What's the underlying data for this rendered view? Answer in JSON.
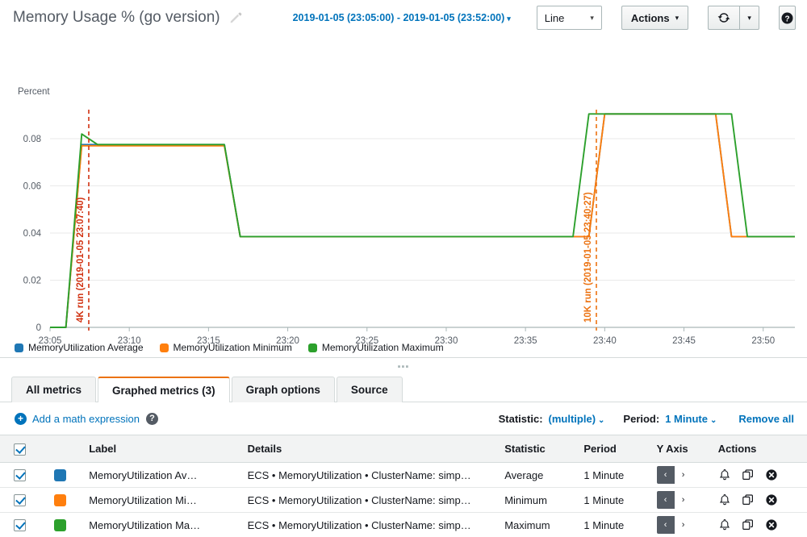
{
  "header": {
    "title": "Memory Usage % (go version)",
    "edit_icon": "pencil-icon",
    "time_range": "2019-01-05 (23:05:00) - 2019-01-05 (23:52:00)",
    "caret": "▾",
    "graph_type": "Line",
    "actions_label": "Actions",
    "refresh_icon": "refresh-icon",
    "help_label": "?"
  },
  "chart_data": {
    "type": "line",
    "title": "Memory Usage % (go version)",
    "xlabel": "",
    "ylabel": "Percent",
    "ylim": [
      0,
      0.09
    ],
    "yticks": [
      0,
      0.02,
      0.04,
      0.06,
      0.08
    ],
    "ytick_labels": [
      "0",
      "0.02",
      "0.04",
      "0.06",
      "0.08"
    ],
    "xticks": [
      "23:05",
      "23:10",
      "23:15",
      "23:20",
      "23:25",
      "23:30",
      "23:35",
      "23:40",
      "23:45",
      "23:50"
    ],
    "grid": true,
    "legend_position": "bottom-left",
    "x_minutes": [
      "23:05",
      "23:06",
      "23:07",
      "23:08",
      "23:09",
      "23:10",
      "23:11",
      "23:12",
      "23:13",
      "23:14",
      "23:15",
      "23:16",
      "23:17",
      "23:18",
      "23:19",
      "23:20",
      "23:21",
      "23:22",
      "23:23",
      "23:24",
      "23:25",
      "23:26",
      "23:27",
      "23:28",
      "23:29",
      "23:30",
      "23:31",
      "23:32",
      "23:33",
      "23:34",
      "23:35",
      "23:36",
      "23:37",
      "23:38",
      "23:39",
      "23:40",
      "23:41",
      "23:42",
      "23:43",
      "23:44",
      "23:45",
      "23:46",
      "23:47",
      "23:48",
      "23:49",
      "23:50",
      "23:51",
      "23:52"
    ],
    "series": [
      {
        "name": "MemoryUtilization Average",
        "color": "#1f77b4",
        "values": [
          0,
          0,
          0.0775,
          0.0775,
          0.0775,
          0.0775,
          0.0775,
          0.0775,
          0.0775,
          0.0775,
          0.0775,
          0.0775,
          0.0385,
          0.0385,
          0.0385,
          0.0385,
          0.0385,
          0.0385,
          0.0385,
          0.0385,
          0.0385,
          0.0385,
          0.0385,
          0.0385,
          0.0385,
          0.0385,
          0.0385,
          0.0385,
          0.0385,
          0.0385,
          0.0385,
          0.0385,
          0.0385,
          0.0385,
          0.0385,
          0.0905,
          0.0905,
          0.0905,
          0.0905,
          0.0905,
          0.0905,
          0.0905,
          0.0905,
          0.0385,
          0.0385,
          0.0385,
          0.0385,
          0.0385
        ]
      },
      {
        "name": "MemoryUtilization Minimum",
        "color": "#ff7f0e",
        "values": [
          0,
          0,
          0.077,
          0.077,
          0.077,
          0.077,
          0.077,
          0.077,
          0.077,
          0.077,
          0.077,
          0.077,
          0.0385,
          0.0385,
          0.0385,
          0.0385,
          0.0385,
          0.0385,
          0.0385,
          0.0385,
          0.0385,
          0.0385,
          0.0385,
          0.0385,
          0.0385,
          0.0385,
          0.0385,
          0.0385,
          0.0385,
          0.0385,
          0.0385,
          0.0385,
          0.0385,
          0.0385,
          0.0385,
          0.0905,
          0.0905,
          0.0905,
          0.0905,
          0.0905,
          0.0905,
          0.0905,
          0.0905,
          0.0385,
          0.0385,
          0.0385,
          0.0385,
          0.0385
        ]
      },
      {
        "name": "MemoryUtilization Maximum",
        "color": "#2ca02c",
        "values": [
          0,
          0,
          0.082,
          0.0775,
          0.0775,
          0.0775,
          0.0775,
          0.0775,
          0.0775,
          0.0775,
          0.0775,
          0.0775,
          0.0385,
          0.0385,
          0.0385,
          0.0385,
          0.0385,
          0.0385,
          0.0385,
          0.0385,
          0.0385,
          0.0385,
          0.0385,
          0.0385,
          0.0385,
          0.0385,
          0.0385,
          0.0385,
          0.0385,
          0.0385,
          0.0385,
          0.0385,
          0.0385,
          0.0385,
          0.0905,
          0.0905,
          0.0905,
          0.0905,
          0.0905,
          0.0905,
          0.0905,
          0.0905,
          0.0905,
          0.0905,
          0.0385,
          0.0385,
          0.0385,
          0.0385
        ]
      }
    ],
    "annotations": [
      {
        "label": "4K run (2019-01-05 23:07:40)",
        "x": "23:07:40",
        "color": "#d13212",
        "style": "dashed"
      },
      {
        "label": "10K run (2019-01-05 23:40:27)",
        "x": "23:40:27",
        "color": "#ec7211",
        "style": "dashed"
      }
    ],
    "legend": [
      {
        "label": "MemoryUtilization Average",
        "color": "#1f77b4"
      },
      {
        "label": "MemoryUtilization Minimum",
        "color": "#ff7f0e"
      },
      {
        "label": "MemoryUtilization Maximum",
        "color": "#2ca02c"
      }
    ]
  },
  "tabs": [
    {
      "label": "All metrics",
      "active": false
    },
    {
      "label": "Graphed metrics (3)",
      "active": true
    },
    {
      "label": "Graph options",
      "active": false
    },
    {
      "label": "Source",
      "active": false
    }
  ],
  "controls": {
    "add_math": "Add a math expression",
    "help_glyph": "?",
    "statistic_label": "Statistic:",
    "statistic_value": "(multiple)",
    "period_label": "Period:",
    "period_value": "1 Minute",
    "caret": "⌄",
    "remove_all": "Remove all"
  },
  "table": {
    "columns": [
      "",
      "",
      "Label",
      "Details",
      "Statistic",
      "Period",
      "Y Axis",
      "Actions"
    ],
    "header_checked": true,
    "rows": [
      {
        "checked": true,
        "color": "#1f77b4",
        "label": "MemoryUtilization Av…",
        "details": "ECS • MemoryUtilization • ClusterName: simp…",
        "statistic": "Average",
        "period": "1 Minute",
        "yaxis_left": "‹",
        "yaxis_right": "›"
      },
      {
        "checked": true,
        "color": "#ff7f0e",
        "label": "MemoryUtilization Mi…",
        "details": "ECS • MemoryUtilization • ClusterName: simp…",
        "statistic": "Minimum",
        "period": "1 Minute",
        "yaxis_left": "‹",
        "yaxis_right": "›"
      },
      {
        "checked": true,
        "color": "#2ca02c",
        "label": "MemoryUtilization Ma…",
        "details": "ECS • MemoryUtilization • ClusterName: simp…",
        "statistic": "Maximum",
        "period": "1 Minute",
        "yaxis_left": "‹",
        "yaxis_right": "›"
      }
    ],
    "action_icons": [
      "alarm-bell-icon",
      "duplicate-icon",
      "remove-circle-icon"
    ]
  },
  "colors": {
    "accent_orange": "#ec7211",
    "link_blue": "#0073bb",
    "annotation_red": "#d13212"
  }
}
